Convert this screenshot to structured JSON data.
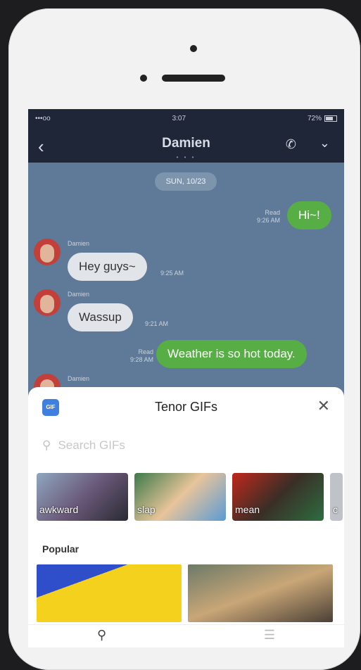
{
  "status": {
    "carrier": "•••oo",
    "time": "3:07",
    "battery": "72%"
  },
  "nav": {
    "back_icon": "‹",
    "title": "Damien",
    "call_icon": "✆",
    "more_icon": "⌄",
    "page_dots": "• • •"
  },
  "chat": {
    "date": "SUN, 10/23",
    "messages": [
      {
        "side": "right",
        "text": "Hi~!",
        "status": "Read",
        "time": "9:26 AM"
      },
      {
        "side": "left",
        "sender": "Damien",
        "text": "Hey guys~",
        "time": "9:25 AM"
      },
      {
        "side": "left",
        "sender": "Damien",
        "text": "Wassup",
        "time": "9:21 AM"
      },
      {
        "side": "right",
        "text": "Weather is so hot today.",
        "status": "Read",
        "time": "9:28 AM"
      },
      {
        "side": "left",
        "sender": "Damien"
      }
    ]
  },
  "gif_sheet": {
    "badge": "GIF",
    "title": "Tenor GIFs",
    "close_icon": "✕",
    "search_icon": "⚲",
    "search_placeholder": "Search GIFs",
    "categories": [
      "awkward",
      "slap",
      "mean",
      "c"
    ],
    "popular_label": "Popular",
    "tab_search_icon": "⚲",
    "tab_list_icon": "☰"
  }
}
